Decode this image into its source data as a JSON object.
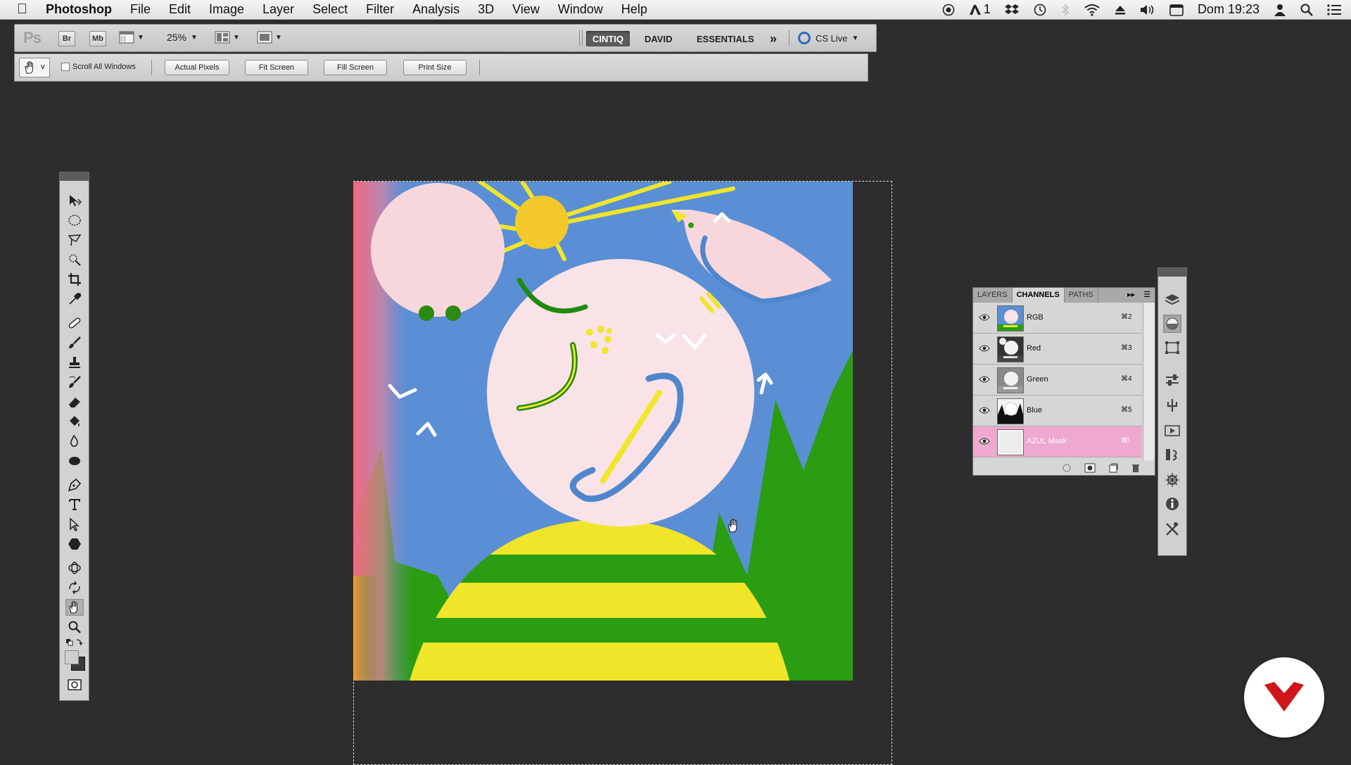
{
  "menubar": {
    "app_name": "Photoshop",
    "items": [
      "File",
      "Edit",
      "Image",
      "Layer",
      "Select",
      "Filter",
      "Analysis",
      "3D",
      "View",
      "Window",
      "Help"
    ],
    "status_count": "1",
    "clock": "Dom 19:23"
  },
  "appbar": {
    "logo": "Ps",
    "bridge": "Br",
    "minibridge": "Mb",
    "zoom": "25%",
    "workspaces": [
      "CINTIQ",
      "DAVID",
      "ESSENTIALS"
    ],
    "active_workspace": "CINTIQ",
    "more": "»",
    "cs_live": "CS Live"
  },
  "options": {
    "tool_caret": "v",
    "scroll_all": "Scroll All Windows",
    "buttons": [
      "Actual Pixels",
      "Fit Screen",
      "Fill Screen",
      "Print Size"
    ]
  },
  "channels_panel": {
    "tabs": [
      "LAYERS",
      "CHANNELS",
      "PATHS"
    ],
    "active_tab": "CHANNELS",
    "rows": [
      {
        "name": "RGB",
        "shortcut": "⌘2"
      },
      {
        "name": "Red",
        "shortcut": "⌘3"
      },
      {
        "name": "Green",
        "shortcut": "⌘4"
      },
      {
        "name": "Blue",
        "shortcut": "⌘5"
      },
      {
        "name": "AZUL Mask",
        "shortcut": "⌘\\"
      }
    ],
    "selected": "AZUL Mask"
  },
  "colors": {
    "sky": "#5a8fd6",
    "grass": "#2a9d12",
    "yellow": "#f1e52a",
    "pink_moon": "#f7dcdf",
    "mask_row": "#efa8cf",
    "badge_red": "#d0161b"
  }
}
